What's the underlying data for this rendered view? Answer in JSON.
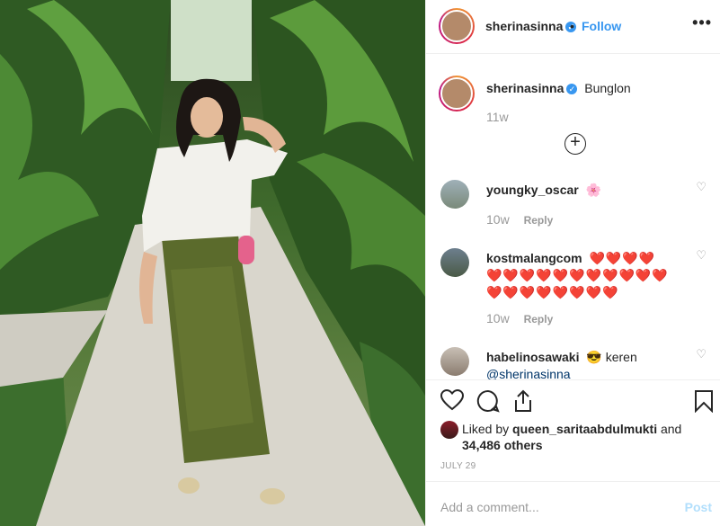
{
  "post": {
    "username": "sherinasinna",
    "follow_label": "Follow",
    "dot": "•",
    "more_label": "•••",
    "caption_text": "Bunglon",
    "caption_time": "11w",
    "load_more": "+"
  },
  "comments": [
    {
      "user": "youngky_oscar",
      "text": "🌸",
      "time": "10w",
      "reply": "Reply"
    },
    {
      "user": "kostmalangcom",
      "text": "❤️❤️❤️❤️❤️❤️❤️❤️❤️❤️❤️❤️❤️❤️❤️❤️❤️❤️❤️❤️❤️❤️❤️",
      "time": "10w",
      "reply": "Reply"
    },
    {
      "user": "habelinosawaki",
      "emoji": "😎",
      "text": "keren",
      "mention": "@sherinasinna",
      "time": "",
      "reply": ""
    }
  ],
  "likes": {
    "prefix": "Liked by ",
    "user": "queen_saritaabdulmukti",
    "and": " and",
    "count": "34,486 others"
  },
  "date": "JULY 29",
  "add_comment": {
    "placeholder": "Add a comment...",
    "post_label": "Post"
  },
  "colors": {
    "accent": "#3897f0",
    "heart": "#ed4956",
    "muted": "#999999"
  }
}
